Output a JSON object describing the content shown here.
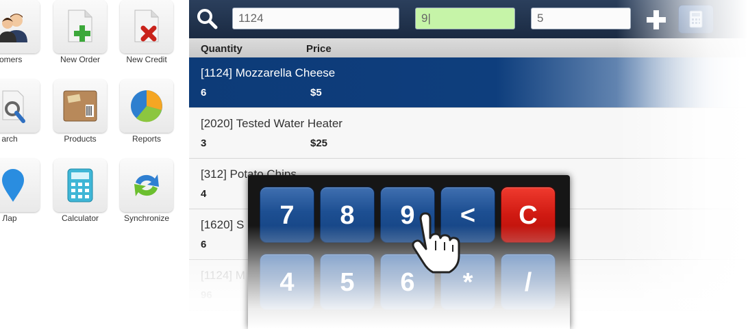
{
  "launcher": {
    "tiles": [
      {
        "label": "tomers",
        "icon": "customers-icon"
      },
      {
        "label": "New Order",
        "icon": "new-order-icon"
      },
      {
        "label": "New Credit",
        "icon": "new-credit-icon"
      },
      {
        "label": "arch",
        "icon": "search-icon"
      },
      {
        "label": "Products",
        "icon": "products-box-icon"
      },
      {
        "label": "Reports",
        "icon": "pie-chart-icon"
      },
      {
        "label": "Лap",
        "icon": "map-pin-icon"
      },
      {
        "label": "Calculator",
        "icon": "calculator-icon"
      },
      {
        "label": "Synchronize",
        "icon": "sync-arrows-icon"
      }
    ]
  },
  "toolbar": {
    "search_value": "1124",
    "quantity_value": "9|",
    "price_value": "5",
    "colors": {
      "bar": "#1f3350",
      "quantity_field": "#c6f4a8",
      "accent": "#0e3e7d"
    }
  },
  "columns": {
    "quantity": "Quantity",
    "price": "Price"
  },
  "items": [
    {
      "name": "[1124] Mozzarella Cheese",
      "qty": "6",
      "price": "$5",
      "selected": true
    },
    {
      "name": "[2020] Tested Water Heater",
      "qty": "3",
      "price": "$25"
    },
    {
      "name": "[312] Potato Chips",
      "qty": "4",
      "price": ""
    },
    {
      "name": "[1620] S",
      "qty": "6",
      "price": ""
    },
    {
      "name": "[1124] M",
      "qty": "96",
      "price": ""
    }
  ],
  "keypad": {
    "row1": [
      "7",
      "8",
      "9",
      "<",
      "C"
    ],
    "row2": [
      "4",
      "5",
      "6",
      "*",
      "/"
    ]
  }
}
